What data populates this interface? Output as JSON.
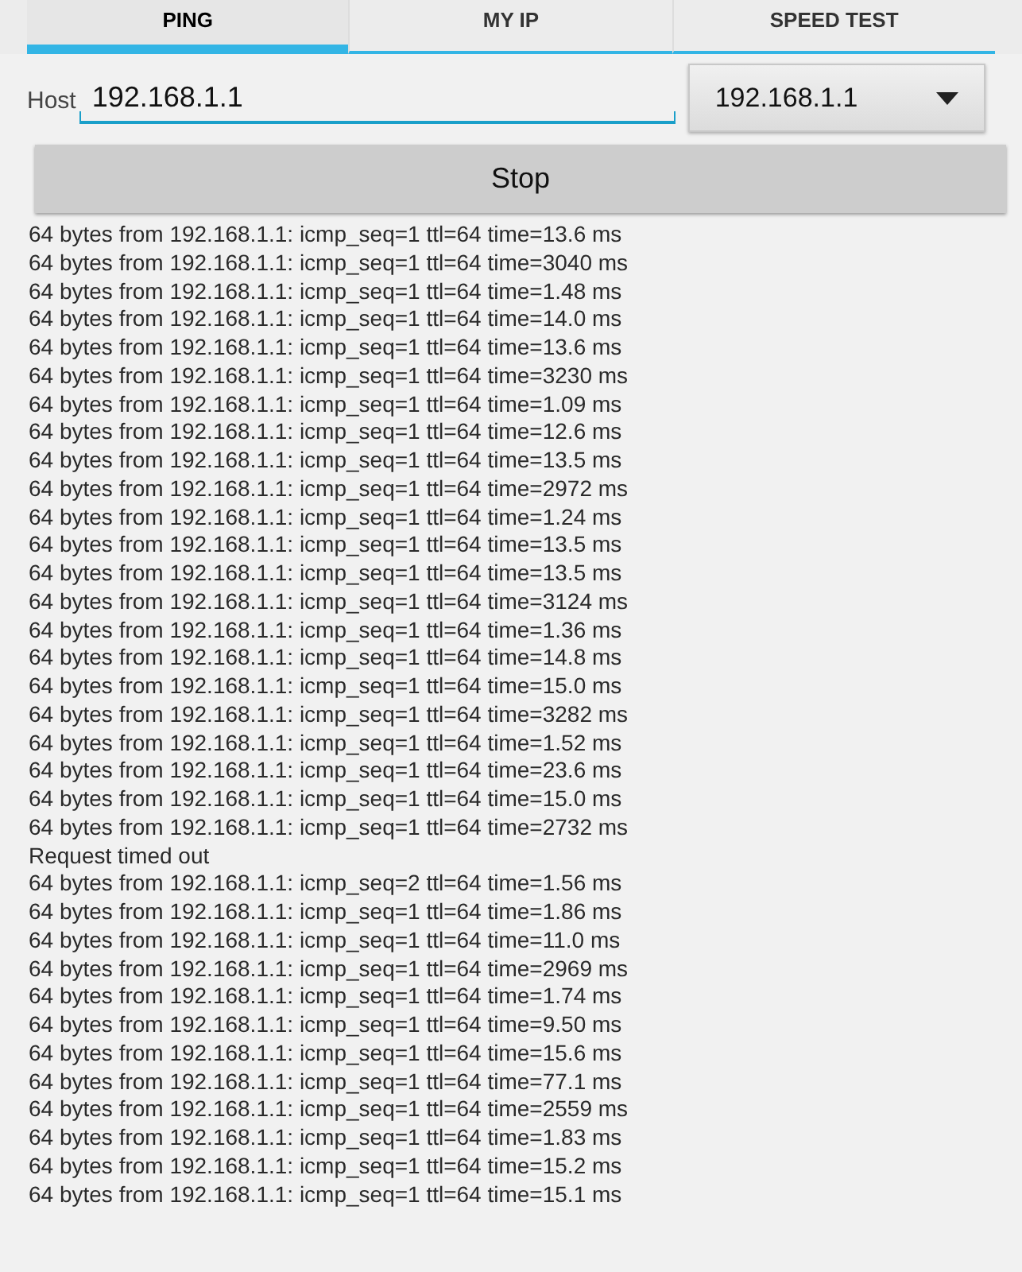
{
  "tabs": [
    {
      "label": "PING",
      "selected": true
    },
    {
      "label": "MY IP",
      "selected": false
    },
    {
      "label": "SPEED TEST",
      "selected": false
    }
  ],
  "host": {
    "label": "Host",
    "value": "192.168.1.1"
  },
  "host_dropdown": {
    "value": "192.168.1.1"
  },
  "stop_button": "Stop",
  "log": [
    "64 bytes from 192.168.1.1: icmp_seq=1 ttl=64 time=13.6 ms",
    "64 bytes from 192.168.1.1: icmp_seq=1 ttl=64 time=3040 ms",
    "64 bytes from 192.168.1.1: icmp_seq=1 ttl=64 time=1.48 ms",
    "64 bytes from 192.168.1.1: icmp_seq=1 ttl=64 time=14.0 ms",
    "64 bytes from 192.168.1.1: icmp_seq=1 ttl=64 time=13.6 ms",
    "64 bytes from 192.168.1.1: icmp_seq=1 ttl=64 time=3230 ms",
    "64 bytes from 192.168.1.1: icmp_seq=1 ttl=64 time=1.09 ms",
    "64 bytes from 192.168.1.1: icmp_seq=1 ttl=64 time=12.6 ms",
    "64 bytes from 192.168.1.1: icmp_seq=1 ttl=64 time=13.5 ms",
    "64 bytes from 192.168.1.1: icmp_seq=1 ttl=64 time=2972 ms",
    "64 bytes from 192.168.1.1: icmp_seq=1 ttl=64 time=1.24 ms",
    "64 bytes from 192.168.1.1: icmp_seq=1 ttl=64 time=13.5 ms",
    "64 bytes from 192.168.1.1: icmp_seq=1 ttl=64 time=13.5 ms",
    "64 bytes from 192.168.1.1: icmp_seq=1 ttl=64 time=3124 ms",
    "64 bytes from 192.168.1.1: icmp_seq=1 ttl=64 time=1.36 ms",
    "64 bytes from 192.168.1.1: icmp_seq=1 ttl=64 time=14.8 ms",
    "64 bytes from 192.168.1.1: icmp_seq=1 ttl=64 time=15.0 ms",
    "64 bytes from 192.168.1.1: icmp_seq=1 ttl=64 time=3282 ms",
    "64 bytes from 192.168.1.1: icmp_seq=1 ttl=64 time=1.52 ms",
    "64 bytes from 192.168.1.1: icmp_seq=1 ttl=64 time=23.6 ms",
    "64 bytes from 192.168.1.1: icmp_seq=1 ttl=64 time=15.0 ms",
    "64 bytes from 192.168.1.1: icmp_seq=1 ttl=64 time=2732 ms",
    "Request timed out",
    "64 bytes from 192.168.1.1: icmp_seq=2 ttl=64 time=1.56 ms",
    "64 bytes from 192.168.1.1: icmp_seq=1 ttl=64 time=1.86 ms",
    "64 bytes from 192.168.1.1: icmp_seq=1 ttl=64 time=11.0 ms",
    "64 bytes from 192.168.1.1: icmp_seq=1 ttl=64 time=2969 ms",
    "64 bytes from 192.168.1.1: icmp_seq=1 ttl=64 time=1.74 ms",
    "64 bytes from 192.168.1.1: icmp_seq=1 ttl=64 time=9.50 ms",
    "64 bytes from 192.168.1.1: icmp_seq=1 ttl=64 time=15.6 ms",
    "64 bytes from 192.168.1.1: icmp_seq=1 ttl=64 time=77.1 ms",
    "64 bytes from 192.168.1.1: icmp_seq=1 ttl=64 time=2559 ms",
    "64 bytes from 192.168.1.1: icmp_seq=1 ttl=64 time=1.83 ms",
    "64 bytes from 192.168.1.1: icmp_seq=1 ttl=64 time=15.2 ms",
    "64 bytes from 192.168.1.1: icmp_seq=1 ttl=64 time=15.1 ms"
  ]
}
